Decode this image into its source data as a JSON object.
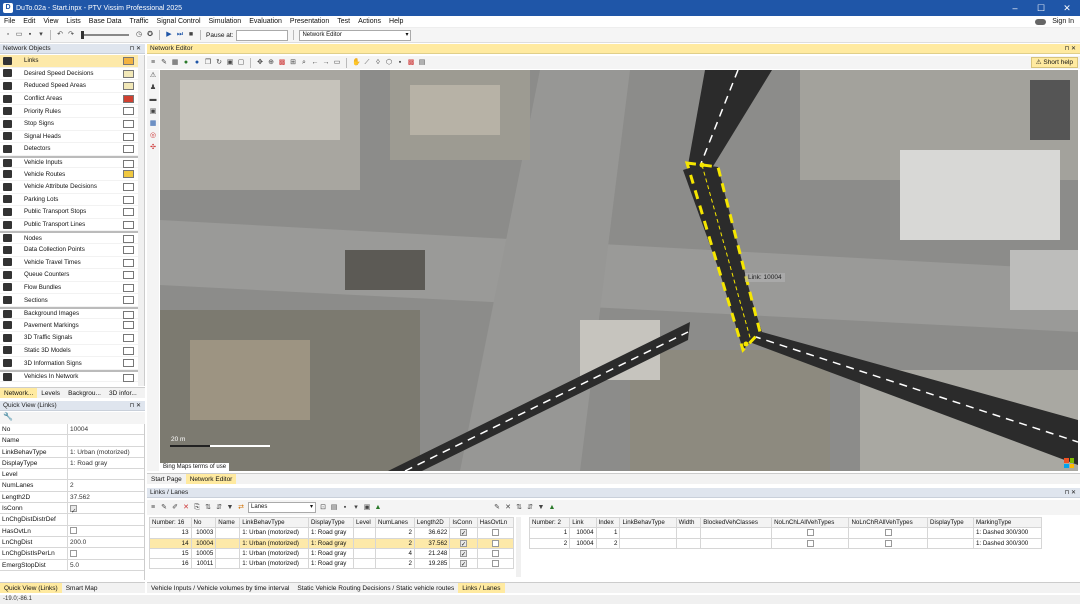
{
  "window": {
    "title": "DuTo.02a - Start.inpx - PTV Vissim Professional 2025",
    "sign_in": "Sign In"
  },
  "menu": [
    "File",
    "Edit",
    "View",
    "Lists",
    "Base Data",
    "Traffic",
    "Signal Control",
    "Simulation",
    "Evaluation",
    "Presentation",
    "Test",
    "Actions",
    "Help"
  ],
  "toolbar": {
    "pause_label": "Pause at:",
    "pause_value": "",
    "editor_select": "Network Editor"
  },
  "network_objects": {
    "title": "Network Objects",
    "items": [
      {
        "label": "Links",
        "icon": "links-icon",
        "selected": true,
        "swatch": "#f3b340"
      },
      {
        "label": "Desired Speed Decisions",
        "icon": "speed-icon",
        "swatch": "#f2e8b8"
      },
      {
        "label": "Reduced Speed Areas",
        "icon": "reduced-speed-icon",
        "swatch": "#f2e8b8"
      },
      {
        "label": "Conflict Areas",
        "icon": "conflict-icon",
        "swatch": "#d04030"
      },
      {
        "label": "Priority Rules",
        "icon": "priority-icon",
        "swatch": "#ffffff"
      },
      {
        "label": "Stop Signs",
        "icon": "stop-sign-icon",
        "swatch": "#ffffff"
      },
      {
        "label": "Signal Heads",
        "icon": "signal-head-icon",
        "swatch": "#ffffff"
      },
      {
        "label": "Detectors",
        "icon": "detector-icon",
        "swatch": "#ffffff"
      },
      {
        "label": "Vehicle Inputs",
        "icon": "vehicle-input-icon",
        "swatch": "#ffffff",
        "gap": true
      },
      {
        "label": "Vehicle Routes",
        "icon": "vehicle-route-icon",
        "swatch": "#f0c840"
      },
      {
        "label": "Vehicle Attribute Decisions",
        "icon": "vehicle-attr-icon",
        "swatch": "#ffffff"
      },
      {
        "label": "Parking Lots",
        "icon": "parking-icon",
        "swatch": "#ffffff"
      },
      {
        "label": "Public Transport Stops",
        "icon": "pt-stop-icon",
        "swatch": "#ffffff"
      },
      {
        "label": "Public Transport Lines",
        "icon": "pt-line-icon",
        "swatch": "#ffffff"
      },
      {
        "label": "Nodes",
        "icon": "node-icon",
        "swatch": "#ffffff",
        "gap": true
      },
      {
        "label": "Data Collection Points",
        "icon": "data-collection-icon",
        "swatch": "#ffffff"
      },
      {
        "label": "Vehicle Travel Times",
        "icon": "travel-time-icon",
        "swatch": "#ffffff"
      },
      {
        "label": "Queue Counters",
        "icon": "queue-counter-icon",
        "swatch": "#ffffff"
      },
      {
        "label": "Flow Bundles",
        "icon": "flow-bundle-icon",
        "swatch": "#ffffff"
      },
      {
        "label": "Sections",
        "icon": "section-icon",
        "swatch": "#ffffff"
      },
      {
        "label": "Background Images",
        "icon": "background-image-icon",
        "swatch": "#ffffff",
        "gap": true
      },
      {
        "label": "Pavement Markings",
        "icon": "pavement-marking-icon",
        "swatch": "#ffffff"
      },
      {
        "label": "3D Traffic Signals",
        "icon": "3d-signal-icon",
        "swatch": "#ffffff"
      },
      {
        "label": "Static 3D Models",
        "icon": "3d-model-icon",
        "swatch": "#ffffff"
      },
      {
        "label": "3D Information Signs",
        "icon": "3d-sign-icon",
        "swatch": "#ffffff"
      },
      {
        "label": "Vehicles In Network",
        "icon": "vehicles-icon",
        "swatch": "#ffffff",
        "gap": true
      }
    ],
    "tabs": [
      "Network...",
      "Levels",
      "Backgrou...",
      "3D infor..."
    ]
  },
  "quick_view": {
    "title": "Quick View (Links)",
    "rows": [
      {
        "key": "No",
        "value": "10004"
      },
      {
        "key": "Name",
        "value": ""
      },
      {
        "key": "LinkBehavType",
        "value": "1: Urban (motorized)"
      },
      {
        "key": "DisplayType",
        "value": "1: Road gray"
      },
      {
        "key": "Level",
        "value": ""
      },
      {
        "key": "NumLanes",
        "value": "2"
      },
      {
        "key": "Length2D",
        "value": "37.562"
      },
      {
        "key": "IsConn",
        "value": "",
        "checkbox": "checked"
      },
      {
        "key": "LnChgDistDistrDef",
        "value": ""
      },
      {
        "key": "HasOvtLn",
        "value": "",
        "checkbox": "unchecked"
      },
      {
        "key": "LnChgDist",
        "value": "200.0"
      },
      {
        "key": "LnChgDistIsPerLn",
        "value": "",
        "checkbox": "unchecked"
      },
      {
        "key": "EmergStopDist",
        "value": "5.0"
      }
    ],
    "tabs": [
      "Quick View (Links)",
      "Smart Map"
    ]
  },
  "network_editor": {
    "title": "Network Editor",
    "short_help": "Short help",
    "tooltip": "Link:  10004",
    "scale": "20 m",
    "bing_notice": "Bing Maps terms of use",
    "tabs": [
      "Start Page",
      "Network Editor"
    ]
  },
  "links_list": {
    "title": "Links / Lanes",
    "select": "Lanes",
    "columns": [
      "Number: 16",
      "No",
      "Name",
      "LinkBehavType",
      "DisplayType",
      "Level",
      "NumLanes",
      "Length2D",
      "IsConn",
      "HasOvtLn"
    ],
    "rows": [
      {
        "n": "13",
        "no": "10003",
        "name": "",
        "lbt": "1: Urban (motorized)",
        "dt": "1: Road gray",
        "level": "",
        "lanes": "2",
        "len": "36.622",
        "isconn": true,
        "ovt": false
      },
      {
        "n": "14",
        "no": "10004",
        "name": "",
        "lbt": "1: Urban (motorized)",
        "dt": "1: Road gray",
        "level": "",
        "lanes": "2",
        "len": "37.562",
        "isconn": true,
        "ovt": false,
        "selected": true
      },
      {
        "n": "15",
        "no": "10005",
        "name": "",
        "lbt": "1: Urban (motorized)",
        "dt": "1: Road gray",
        "level": "",
        "lanes": "4",
        "len": "21.248",
        "isconn": true,
        "ovt": false
      },
      {
        "n": "16",
        "no": "10011",
        "name": "",
        "lbt": "1: Urban (motorized)",
        "dt": "1: Road gray",
        "level": "",
        "lanes": "2",
        "len": "19.285",
        "isconn": true,
        "ovt": false
      }
    ]
  },
  "lanes_list": {
    "columns": [
      "Number: 2",
      "Link",
      "Index",
      "LinkBehavType",
      "Width",
      "BlockedVehClasses",
      "NoLnChLAllVehTypes",
      "NoLnChRAllVehTypes",
      "DisplayType",
      "MarkingType"
    ],
    "rows": [
      {
        "n": "1",
        "link": "10004",
        "index": "1",
        "lbt": "",
        "width": "",
        "blocked": "",
        "nol": false,
        "nor": false,
        "dt": "",
        "marking": "1: Dashed 300/300"
      },
      {
        "n": "2",
        "link": "10004",
        "index": "2",
        "lbt": "",
        "width": "",
        "blocked": "",
        "nol": false,
        "nor": false,
        "dt": "",
        "marking": "1: Dashed 300/300"
      }
    ]
  },
  "bottom_tabs": [
    "Vehicle Inputs / Vehicle volumes by time interval",
    "Static Vehicle Routing Decisions / Static vehicle routes",
    "Links / Lanes"
  ],
  "status": "-19.0;-86.1",
  "colors": {
    "accent": "#1f56a8",
    "selection": "#fde9a9",
    "link_highlight": "#f5e600"
  }
}
